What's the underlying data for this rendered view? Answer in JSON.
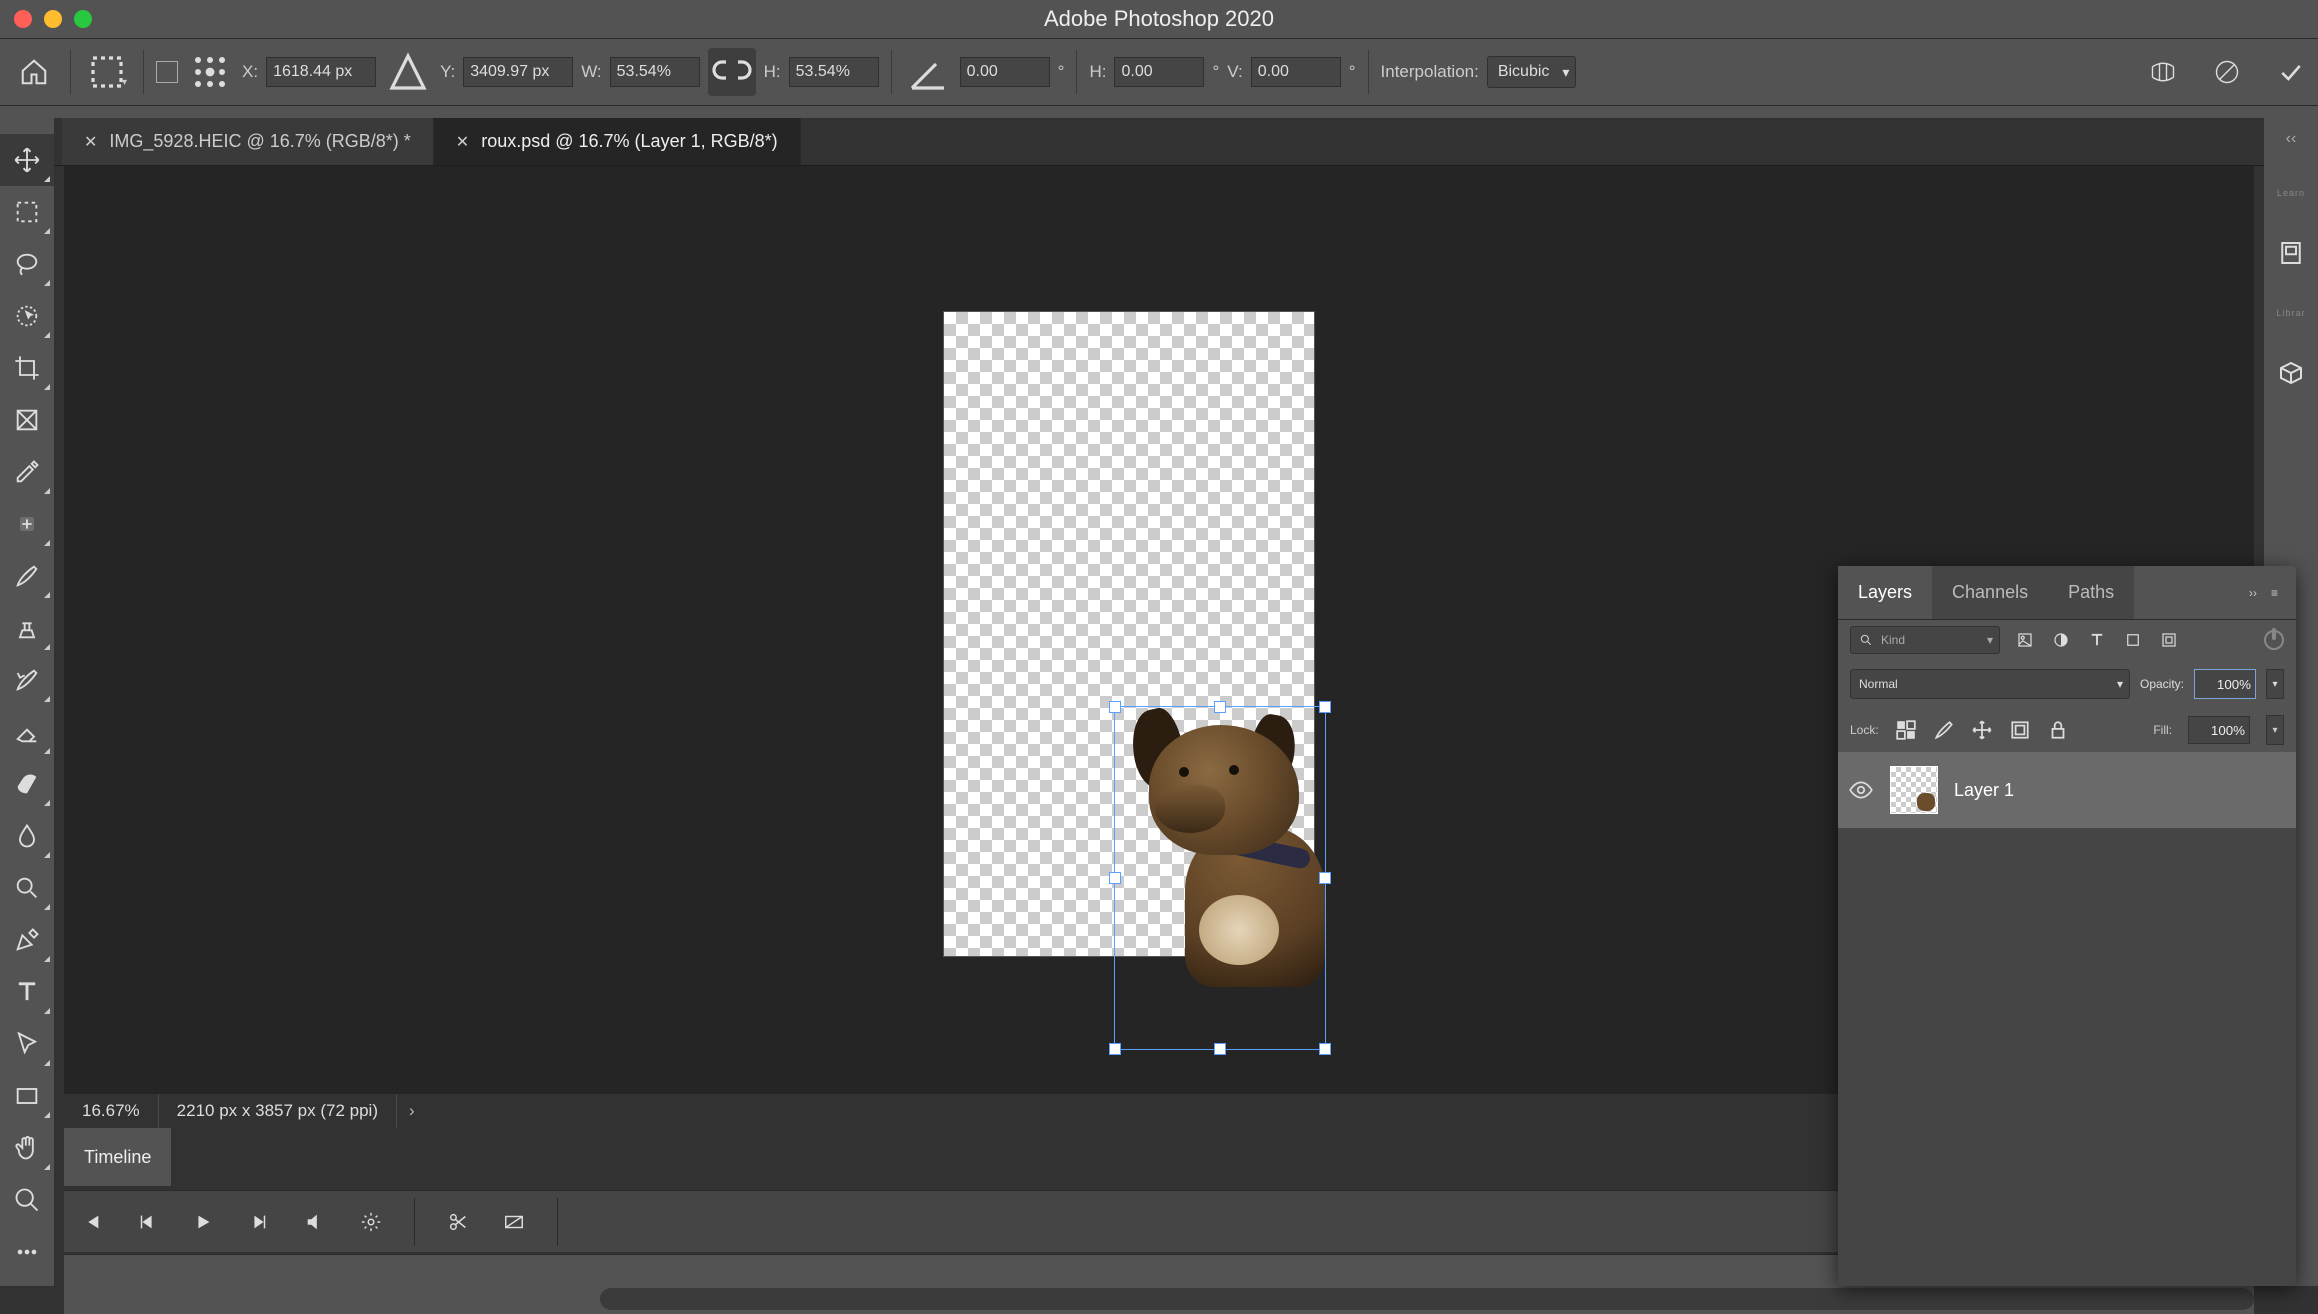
{
  "app": {
    "title": "Adobe Photoshop 2020"
  },
  "options": {
    "x_label": "X:",
    "x_value": "1618.44 px",
    "y_label": "Y:",
    "y_value": "3409.97 px",
    "w_label": "W:",
    "w_value": "53.54%",
    "h_label": "H:",
    "h_value": "53.54%",
    "angle_value": "0.00",
    "skew_h_label": "H:",
    "skew_h_value": "0.00",
    "skew_v_label": "V:",
    "skew_v_value": "0.00",
    "interp_label": "Interpolation:",
    "interp_value": "Bicubic"
  },
  "tabs": [
    {
      "label": "IMG_5928.HEIC @ 16.7% (RGB/8*) *",
      "active": false
    },
    {
      "label": "roux.psd @ 16.7% (Layer 1, RGB/8*)",
      "active": true
    }
  ],
  "status": {
    "zoom": "16.67%",
    "dims": "2210 px x 3857 px (72 ppi)"
  },
  "timeline": {
    "tab": "Timeline"
  },
  "layers_panel": {
    "tabs": [
      "Layers",
      "Channels",
      "Paths"
    ],
    "active_tab": 0,
    "kind_placeholder": "Kind",
    "blend_mode": "Normal",
    "opacity_label": "Opacity:",
    "opacity_value": "100%",
    "lock_label": "Lock:",
    "fill_label": "Fill:",
    "fill_value": "100%",
    "layers": [
      {
        "name": "Layer 1",
        "visible": true
      }
    ]
  },
  "right_strip": [
    "Learn",
    "Libraries"
  ]
}
